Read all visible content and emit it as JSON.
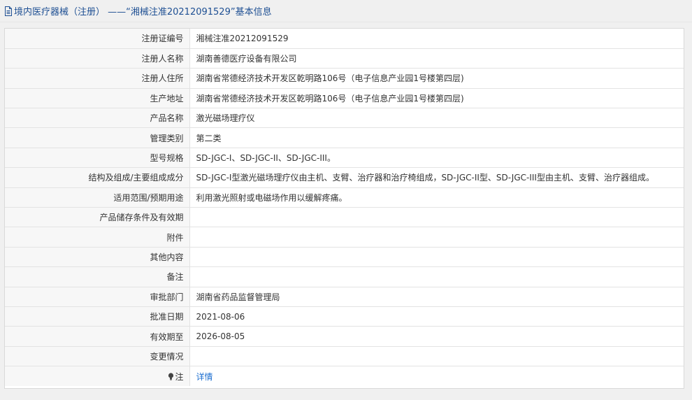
{
  "header": {
    "title": "境内医疗器械（注册） ——“湘械注准20212091529”基本信息"
  },
  "rows": [
    {
      "label": "注册证编号",
      "value": "湘械注准20212091529"
    },
    {
      "label": "注册人名称",
      "value": "湖南善德医疗设备有限公司"
    },
    {
      "label": "注册人住所",
      "value": "湖南省常德经济技术开发区乾明路106号（电子信息产业园1号楼第四层)"
    },
    {
      "label": "生产地址",
      "value": "湖南省常德经济技术开发区乾明路106号（电子信息产业园1号楼第四层)"
    },
    {
      "label": "产品名称",
      "value": "激光磁场理疗仪"
    },
    {
      "label": "管理类别",
      "value": "第二类"
    },
    {
      "label": "型号规格",
      "value": "SD-JGC-I、SD-JGC-II、SD-JGC-III。"
    },
    {
      "label": "结构及组成/主要组成成分",
      "value": "SD-JGC-I型激光磁场理疗仪由主机、支臂、治疗器和治疗椅组成，SD-JGC-II型、SD-JGC-III型由主机、支臂、治疗器组成。"
    },
    {
      "label": "适用范围/预期用途",
      "value": "利用激光照射或电磁场作用以缓解疼痛。"
    },
    {
      "label": "产品储存条件及有效期",
      "value": ""
    },
    {
      "label": "附件",
      "value": ""
    },
    {
      "label": "其他内容",
      "value": ""
    },
    {
      "label": "备注",
      "value": ""
    },
    {
      "label": "审批部门",
      "value": "湖南省药品监督管理局"
    },
    {
      "label": "批准日期",
      "value": "2021-08-06"
    },
    {
      "label": "有效期至",
      "value": "2026-08-05"
    },
    {
      "label": "变更情况",
      "value": ""
    }
  ],
  "note_row": {
    "label": "注",
    "link_text": "详情"
  },
  "colors": {
    "title": "#1e4f93",
    "link": "#1e6fd0",
    "label_bg": "#f7f7f7",
    "border": "#e3e3e3"
  },
  "icons": {
    "title_icon": "document-icon",
    "note_icon": "lightbulb-icon"
  }
}
